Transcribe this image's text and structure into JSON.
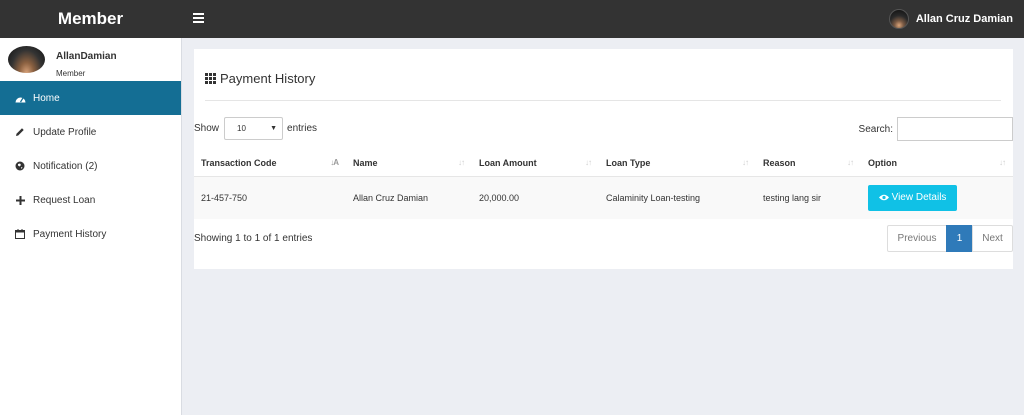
{
  "header": {
    "brand": "Member",
    "user_name": "Allan Cruz Damian"
  },
  "sidebar": {
    "profile": {
      "name": "AllanDamian",
      "role": "Member"
    },
    "items": [
      {
        "label": "Home",
        "icon": "dashboard-icon",
        "active": true
      },
      {
        "label": "Update Profile",
        "icon": "pencil-icon",
        "active": false
      },
      {
        "label": "Notification (2)",
        "icon": "globe-icon",
        "active": false
      },
      {
        "label": "Request Loan",
        "icon": "plus-icon",
        "active": false
      },
      {
        "label": "Payment History",
        "icon": "calendar-icon",
        "active": false
      }
    ]
  },
  "main": {
    "title": "Payment History",
    "show_label": "Show",
    "entries_value": "10",
    "entries_label": "entries",
    "search_label": "Search:",
    "search_value": "",
    "table": {
      "headers": [
        "Transaction Code",
        "Name",
        "Loan Amount",
        "Loan Type",
        "Reason",
        "Option"
      ],
      "rows": [
        {
          "transaction_code": "21-457-750",
          "name": "Allan Cruz Damian",
          "loan_amount": "20,000.00",
          "loan_type": "Calaminity Loan-testing",
          "reason": "testing lang sir",
          "option_label": "View Details"
        }
      ]
    },
    "info": "Showing 1 to 1 of 1 entries",
    "pagination": {
      "previous": "Previous",
      "current": "1",
      "next": "Next"
    }
  },
  "colors": {
    "topbar": "#333333",
    "active_nav": "#146e94",
    "view_button": "#10c1e6",
    "page_active": "#2f7ab9",
    "background": "#eceef3"
  }
}
